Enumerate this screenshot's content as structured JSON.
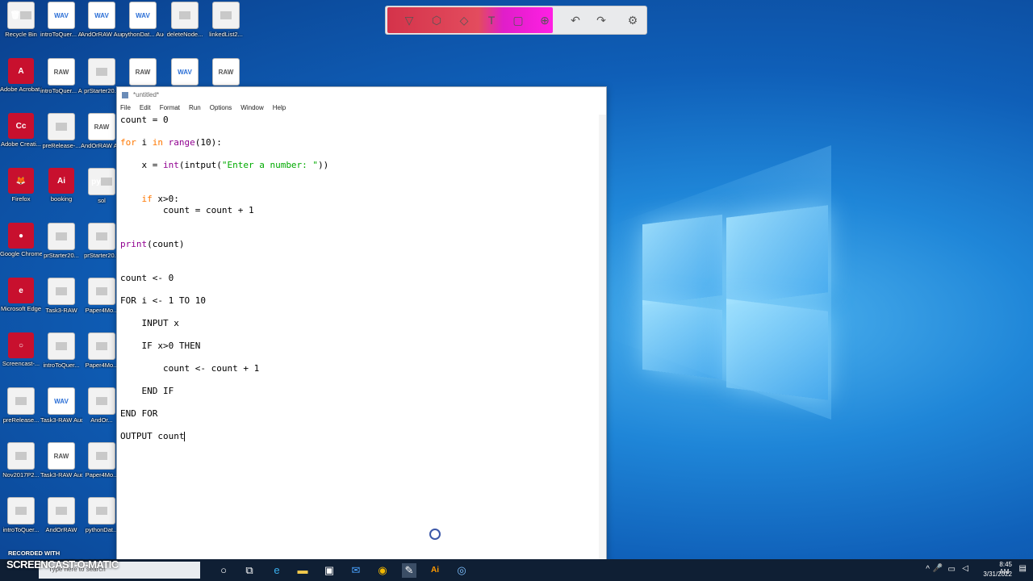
{
  "desktop_icons": [
    {
      "id": "recycle-bin",
      "label": "Recycle Bin",
      "kind": "file",
      "glyph": "🗑"
    },
    {
      "id": "audio1",
      "label": "introToQuer... Audio Extra...",
      "kind": "wav",
      "glyph": "WAV"
    },
    {
      "id": "audio2",
      "label": "AndOrRAW Audio Extra...",
      "kind": "wav",
      "glyph": "WAV"
    },
    {
      "id": "audio3",
      "label": "pythonDat... Audio Extr...",
      "kind": "wav",
      "glyph": "WAV"
    },
    {
      "id": "deleteNode",
      "label": "deleteNode...",
      "kind": "file",
      "glyph": ""
    },
    {
      "id": "linkedList",
      "label": "linkedList2...",
      "kind": "file",
      "glyph": ""
    },
    {
      "id": "acrobat",
      "label": "Adobe Acrobat DC",
      "kind": "app",
      "glyph": "A"
    },
    {
      "id": "audio4",
      "label": "introToQuer... Audio Extra...",
      "kind": "raw",
      "glyph": "RAW"
    },
    {
      "id": "prStarter",
      "label": "prStarter20...",
      "kind": "file",
      "glyph": ""
    },
    {
      "id": "raw2",
      "label": "",
      "kind": "raw",
      "glyph": "RAW"
    },
    {
      "id": "wav5",
      "label": "",
      "kind": "wav",
      "glyph": "WAV"
    },
    {
      "id": "raw3",
      "label": "",
      "kind": "raw",
      "glyph": "RAW"
    },
    {
      "id": "creative",
      "label": "Adobe Creati...",
      "kind": "app",
      "glyph": "Cc"
    },
    {
      "id": "prerelease1",
      "label": "preRelease-...",
      "kind": "file",
      "glyph": ""
    },
    {
      "id": "andor2",
      "label": "AndOrRAW Audio Extr...",
      "kind": "raw",
      "glyph": "RAW"
    },
    {
      "id": "firefox",
      "label": "Firefox",
      "kind": "app",
      "glyph": "🦊"
    },
    {
      "id": "booking",
      "label": "booking",
      "kind": "app",
      "glyph": "Ai"
    },
    {
      "id": "sol",
      "label": "sol",
      "kind": "file",
      "glyph": "py"
    },
    {
      "id": "chrome",
      "label": "Google Chrome",
      "kind": "app",
      "glyph": "●"
    },
    {
      "id": "prstarter2",
      "label": "prStarter20...",
      "kind": "file",
      "glyph": ""
    },
    {
      "id": "prstarter3",
      "label": "prStarter20...",
      "kind": "file",
      "glyph": ""
    },
    {
      "id": "edge",
      "label": "Microsoft Edge",
      "kind": "app",
      "glyph": "e"
    },
    {
      "id": "task3raw",
      "label": "Task3-RAW",
      "kind": "file",
      "glyph": ""
    },
    {
      "id": "paper4mo",
      "label": "Paper4Mo...",
      "kind": "file",
      "glyph": ""
    },
    {
      "id": "screencast",
      "label": "Screencast-...",
      "kind": "app",
      "glyph": "○"
    },
    {
      "id": "introquer",
      "label": "introToQuer...",
      "kind": "file",
      "glyph": ""
    },
    {
      "id": "paper4mo2",
      "label": "Paper4Mo...",
      "kind": "file",
      "glyph": ""
    },
    {
      "id": "prerelease2",
      "label": "preRelease...",
      "kind": "file",
      "glyph": ""
    },
    {
      "id": "task3audio",
      "label": "Task3-RAW Audio Ex...",
      "kind": "wav",
      "glyph": "WAV"
    },
    {
      "id": "andor3",
      "label": "AndOr...",
      "kind": "file",
      "glyph": ""
    },
    {
      "id": "nov2017",
      "label": "Nov2017P2...",
      "kind": "file",
      "glyph": ""
    },
    {
      "id": "task3audio2",
      "label": "Task3-RAW Audio Ex...",
      "kind": "raw",
      "glyph": "RAW"
    },
    {
      "id": "paper4mo3",
      "label": "Paper4Mo...",
      "kind": "file",
      "glyph": ""
    },
    {
      "id": "introquer2",
      "label": "introToQuer...",
      "kind": "file",
      "glyph": ""
    },
    {
      "id": "andorraw",
      "label": "AndOrRAW",
      "kind": "file",
      "glyph": ""
    },
    {
      "id": "pythondat",
      "label": "pythonDat...",
      "kind": "file",
      "glyph": ""
    }
  ],
  "annotation_toolbar": {
    "tools": [
      "▽",
      "⬡",
      "◇",
      "T",
      "▢",
      "⊕",
      "↶",
      "↷",
      "⚙"
    ]
  },
  "editor": {
    "title": "*untitled*",
    "menu": [
      "File",
      "Edit",
      "Format",
      "Run",
      "Options",
      "Window",
      "Help"
    ],
    "code": {
      "l1": "count = 0",
      "l2_kw": "for",
      "l2_a": " i ",
      "l2_kw2": "in",
      "l2_b": " ",
      "l2_bi": "range",
      "l2_c": "(10):",
      "l3_a": "    x = ",
      "l3_bi": "int",
      "l3_b": "(intput(",
      "l3_str": "\"Enter a number: \"",
      "l3_c": "))",
      "l4_kw": "if",
      "l4_a": " x>0:",
      "l5": "        count = count + 1",
      "l6_bi": "print",
      "l6_a": "(count)",
      "p1": "count <- 0",
      "p2": "FOR i <- 1 TO 10",
      "p3": "    INPUT x",
      "p4": "    IF x>0 THEN",
      "p5": "        count <- count + 1",
      "p6": "    END IF",
      "p7": "END FOR",
      "p8": "OUTPUT count"
    }
  },
  "taskbar": {
    "search_placeholder": "Type here to search",
    "time": "8:45 AM",
    "date": "3/31/2022"
  },
  "watermark": {
    "recorded_with": "RECORDED WITH",
    "brand": "SCREENCAST-O-MATIC"
  }
}
